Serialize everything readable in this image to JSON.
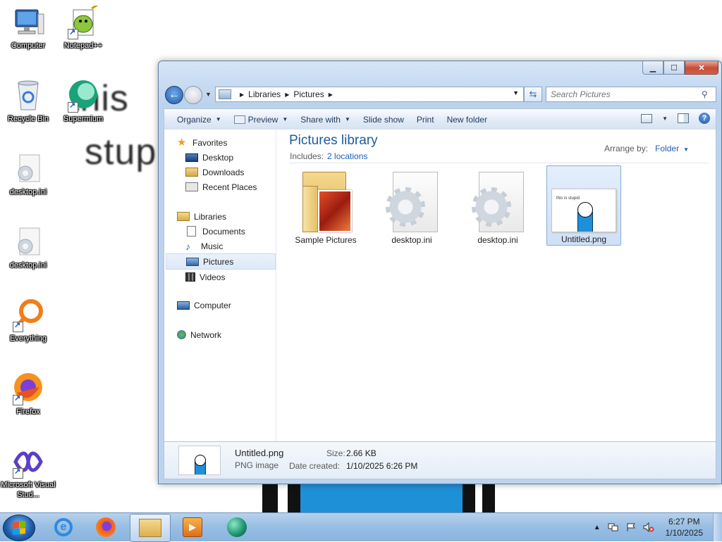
{
  "desktop": {
    "icons": [
      {
        "label": "Computer",
        "icon": "computer-icon"
      },
      {
        "label": "Notepad++",
        "icon": "notepad-plus-plus-icon"
      },
      {
        "label": "Recycle Bin",
        "icon": "recycle-bin-icon"
      },
      {
        "label": "Supermium",
        "icon": "supermium-icon"
      },
      {
        "label": "desktop.ini",
        "icon": "ini-file-icon"
      },
      {
        "label": "desktop.ini",
        "icon": "ini-file-icon"
      },
      {
        "label": "Everything",
        "icon": "everything-icon"
      },
      {
        "label": "Firefox",
        "icon": "firefox-icon"
      },
      {
        "label": "Microsoft Visual Stud...",
        "icon": "visual-studio-icon"
      }
    ],
    "wallpaper_text": [
      "this",
      "stup"
    ]
  },
  "explorer": {
    "caption_buttons": {
      "minimize": "▁",
      "maximize": "☐",
      "close": "✕"
    },
    "address": {
      "crumbs": [
        "Libraries",
        "Pictures"
      ]
    },
    "search": {
      "placeholder": "Search Pictures"
    },
    "commands": {
      "organize": "Organize",
      "preview": "Preview",
      "share_with": "Share with",
      "slide_show": "Slide show",
      "print": "Print",
      "new_folder": "New folder"
    },
    "nav": {
      "favorites": {
        "label": "Favorites",
        "items": [
          "Desktop",
          "Downloads",
          "Recent Places"
        ]
      },
      "libraries": {
        "label": "Libraries",
        "items": [
          "Documents",
          "Music",
          "Pictures",
          "Videos"
        ],
        "selected": "Pictures"
      },
      "computer": "Computer",
      "network": "Network"
    },
    "library": {
      "title": "Pictures library",
      "includes_label": "Includes:",
      "includes_link": "2 locations",
      "arrange_label": "Arrange by:",
      "arrange_value": "Folder"
    },
    "files": [
      {
        "name": "Sample Pictures",
        "kind": "folder"
      },
      {
        "name": "desktop.ini",
        "kind": "ini"
      },
      {
        "name": "desktop.ini",
        "kind": "ini"
      },
      {
        "name": "Untitled.png",
        "kind": "png",
        "selected": true
      }
    ],
    "details": {
      "name": "Untitled.png",
      "type": "PNG image",
      "size_label": "Size:",
      "size_value": "2.66 KB",
      "date_label": "Date created:",
      "date_value": "1/10/2025 6:26 PM",
      "thumb_text": "this is stupid"
    }
  },
  "taskbar": {
    "apps": [
      "start-button",
      "internet-explorer",
      "firefox",
      "windows-explorer",
      "media-player",
      "supermium"
    ],
    "clock": {
      "time": "6:27 PM",
      "date": "1/10/2025"
    },
    "tray_arrow": "▲"
  },
  "colors": {
    "library_title": "#1c5b9c",
    "link": "#1c5fb8",
    "taskbar": "#99bfe4",
    "selection": "#cfe0f6"
  }
}
